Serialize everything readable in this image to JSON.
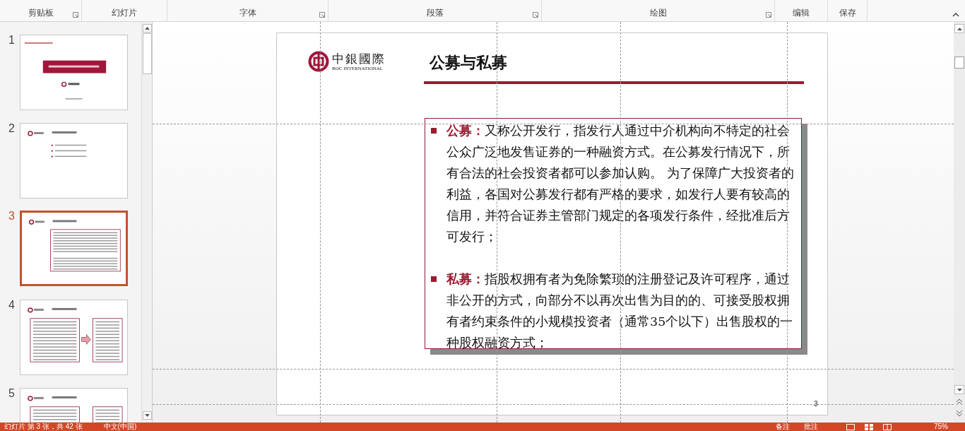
{
  "ribbon": {
    "groups": [
      {
        "label": "剪贴板",
        "launcher": true
      },
      {
        "label": "幻灯片",
        "launcher": false
      },
      {
        "label": "字体",
        "launcher": true
      },
      {
        "label": "段落",
        "launcher": true
      },
      {
        "label": "绘图",
        "launcher": true
      },
      {
        "label": "编辑",
        "launcher": false
      },
      {
        "label": "保存",
        "launcher": false
      }
    ]
  },
  "thumbnails": [
    {
      "number": "1",
      "selected": false,
      "kind": "title"
    },
    {
      "number": "2",
      "selected": false,
      "kind": "list"
    },
    {
      "number": "3",
      "selected": true,
      "kind": "box"
    },
    {
      "number": "4",
      "selected": false,
      "kind": "twobox"
    },
    {
      "number": "5",
      "selected": false,
      "kind": "twobox"
    }
  ],
  "slide": {
    "logo": {
      "name": "中銀國際",
      "subtitle": "BOC INTERNATIONAL"
    },
    "title": "公募与私募",
    "bullets": [
      {
        "text": "**公募：**又称公开发行，指发行人通过中介机构向不特定的社会公众广泛地发售证券的一种融资方式。在公募发行情况下，所有合法的社会投资者都可以参加认购。 为了保障广大投资者的利益，各国对公募发行都有严格的要求，如发行人要有较高的信用，并符合证券主管部门规定的各项发行条件，经批准后方可发行；"
      },
      {
        "text": "**私募：**指股权拥有者为免除繁琐的注册登记及许可程序，通过非公开的方式，向部分不以再次出售为目的的、可接受股权拥有者约束条件的小规模投资者（通常35个以下）出售股权的一种股权融资方式；"
      }
    ],
    "page_number": "3"
  },
  "status_bar": {
    "slide_info": "幻灯片 第 3 张，共 42 张",
    "language": "中文(中国)",
    "notes": "备注",
    "comments": "批注",
    "zoom": "75%"
  }
}
